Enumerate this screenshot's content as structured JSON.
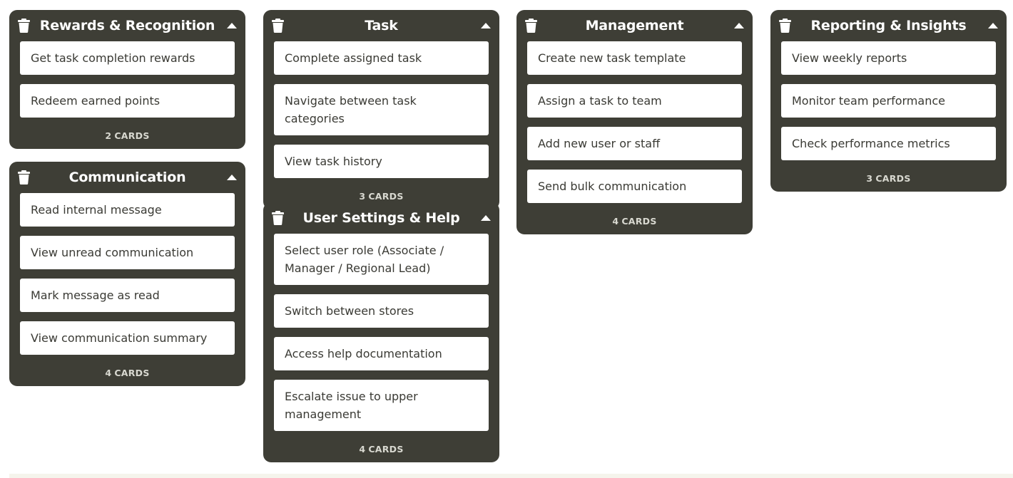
{
  "board": {
    "colors": {
      "group_bg": "#3e3e36",
      "card_bg": "#ffffff",
      "card_text": "#3a3a34",
      "header_text": "#ffffff",
      "count_text": "#d8d8d0"
    },
    "icons": {
      "delete": "trash-icon",
      "collapse": "caret-up-icon"
    },
    "cards_suffix": "CARDS",
    "groups": [
      {
        "title": "Rewards & Recognition",
        "count": "2",
        "cards": [
          "Get task completion rewards",
          "Redeem earned points"
        ]
      },
      {
        "title": "Communication",
        "count": "4",
        "cards": [
          "Read internal message",
          "View unread communication",
          "Mark message as read",
          "View communication summary"
        ]
      },
      {
        "title": "Task",
        "count": "3",
        "cards": [
          "Complete assigned task",
          "Navigate between task categories",
          "View task history"
        ]
      },
      {
        "title": "User Settings & Help",
        "count": "4",
        "cards": [
          "Select user role (Associate / Manager / Regional Lead)",
          "Switch between stores",
          "Access help documentation",
          "Escalate issue to upper management"
        ]
      },
      {
        "title": "Management",
        "count": "4",
        "cards": [
          "Create new task template",
          "Assign a task to team",
          "Add new user or staff",
          "Send bulk communication"
        ]
      },
      {
        "title": "Reporting & Insights",
        "count": "3",
        "cards": [
          "View weekly reports",
          "Monitor team performance",
          "Check performance metrics"
        ]
      }
    ]
  }
}
